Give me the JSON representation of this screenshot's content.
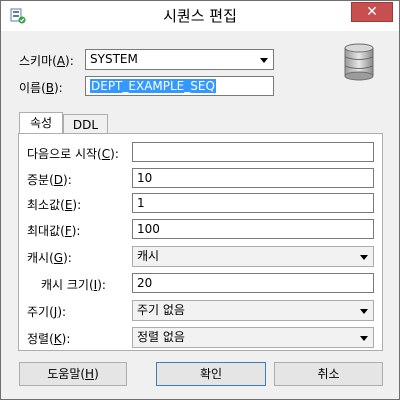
{
  "window": {
    "title": "시퀀스 편집",
    "close_label": "✕"
  },
  "schema": {
    "label_prefix": "스키마(",
    "label_key": "A",
    "label_suffix": "):",
    "value": "SYSTEM"
  },
  "name": {
    "label_prefix": "이름(",
    "label_key": "B",
    "label_suffix": "):",
    "value": "DEPT_EXAMPLE_SEQ"
  },
  "tabs": [
    {
      "label": "속성",
      "active": true
    },
    {
      "label": "DDL",
      "active": false
    }
  ],
  "properties": {
    "start_with": {
      "label_prefix": "다음으로 시작(",
      "label_key": "C",
      "label_suffix": "):",
      "value": ""
    },
    "increment": {
      "label_prefix": "증분(",
      "label_key": "D",
      "label_suffix": "):",
      "value": "10"
    },
    "min_value": {
      "label_prefix": "최소값(",
      "label_key": "E",
      "label_suffix": "):",
      "value": "1"
    },
    "max_value": {
      "label_prefix": "최대값(",
      "label_key": "F",
      "label_suffix": "):",
      "value": "100"
    },
    "cache": {
      "label_prefix": "캐시(",
      "label_key": "G",
      "label_suffix": "):",
      "value": "캐시"
    },
    "cache_size": {
      "label_prefix": "캐시 크기(",
      "label_key": "I",
      "label_suffix": "):",
      "value": "20"
    },
    "cycle": {
      "label_prefix": "주기(",
      "label_key": "J",
      "label_suffix": "):",
      "value": "주기 없음"
    },
    "order": {
      "label_prefix": "정렬(",
      "label_key": "K",
      "label_suffix": "):",
      "value": "정렬 없음"
    }
  },
  "buttons": {
    "help": {
      "label_prefix": "도움말(",
      "label_key": "H",
      "label_suffix": ")"
    },
    "ok": "확인",
    "cancel": "취소"
  },
  "icons": {
    "app": "sequence-app-icon",
    "database": "database-icon"
  }
}
